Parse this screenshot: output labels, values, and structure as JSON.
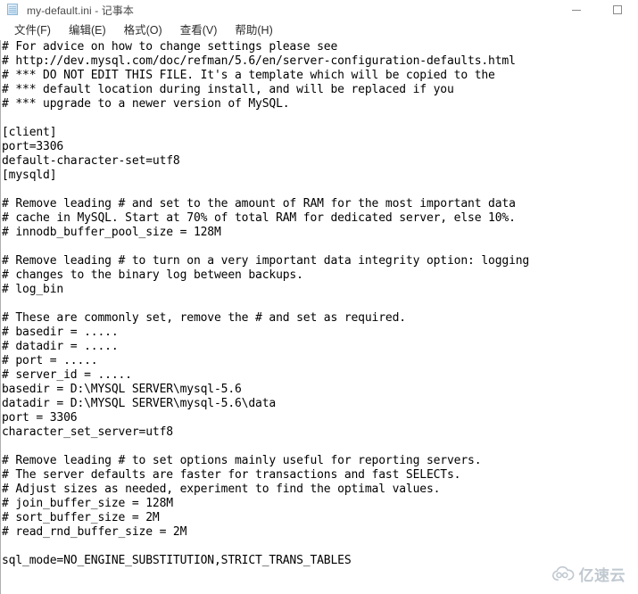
{
  "window": {
    "title": "my-default.ini - 记事本",
    "file_icon": "notepad-document-icon",
    "controls": {
      "minimize_label": "最小化",
      "maximize_label": "最大化"
    }
  },
  "menubar": {
    "items": [
      {
        "label": "文件(F)",
        "name": "menu-file"
      },
      {
        "label": "编辑(E)",
        "name": "menu-edit"
      },
      {
        "label": "格式(O)",
        "name": "menu-format"
      },
      {
        "label": "查看(V)",
        "name": "menu-view"
      },
      {
        "label": "帮助(H)",
        "name": "menu-help"
      }
    ]
  },
  "editor": {
    "content": "# For advice on how to change settings please see\n# http://dev.mysql.com/doc/refman/5.6/en/server-configuration-defaults.html\n# *** DO NOT EDIT THIS FILE. It's a template which will be copied to the\n# *** default location during install, and will be replaced if you\n# *** upgrade to a newer version of MySQL.\n\n[client]\nport=3306\ndefault-character-set=utf8\n[mysqld]\n\n# Remove leading # and set to the amount of RAM for the most important data\n# cache in MySQL. Start at 70% of total RAM for dedicated server, else 10%.\n# innodb_buffer_pool_size = 128M\n\n# Remove leading # to turn on a very important data integrity option: logging\n# changes to the binary log between backups.\n# log_bin\n\n# These are commonly set, remove the # and set as required.\n# basedir = .....\n# datadir = .....\n# port = .....\n# server_id = .....\nbasedir = D:\\MYSQL SERVER\\mysql-5.6\ndatadir = D:\\MYSQL SERVER\\mysql-5.6\\data\nport = 3306\ncharacter_set_server=utf8\n\n# Remove leading # to set options mainly useful for reporting servers.\n# The server defaults are faster for transactions and fast SELECTs.\n# Adjust sizes as needed, experiment to find the optimal values.\n# join_buffer_size = 128M\n# sort_buffer_size = 2M\n# read_rnd_buffer_size = 2M\n\nsql_mode=NO_ENGINE_SUBSTITUTION,STRICT_TRANS_TABLES\n"
  },
  "watermark": {
    "text": "亿速云",
    "icon": "cloud-icon"
  },
  "colors": {
    "background": "#ffffff",
    "text": "#000000",
    "title_text": "#4b4b4b",
    "menu_text": "#2b2b2b",
    "control_glyph": "#8a8a8a",
    "watermark": "#9aa7b4"
  }
}
